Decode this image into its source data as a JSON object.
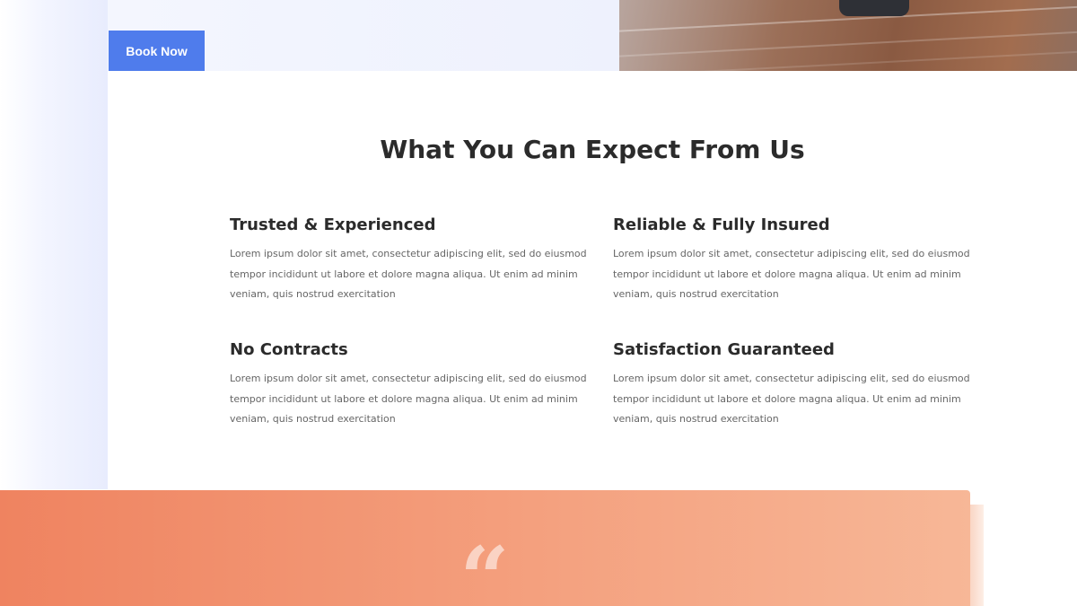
{
  "hero": {
    "book_button_label": "Book Now"
  },
  "features_section": {
    "title": "What You Can Expect From Us",
    "items": [
      {
        "title": "Trusted & Experienced",
        "body": "Lorem ipsum dolor sit amet, consectetur adipiscing elit, sed do eiusmod tempor incididunt ut labore et dolore magna aliqua. Ut enim ad minim veniam, quis nostrud exercitation"
      },
      {
        "title": "Reliable & Fully Insured",
        "body": "Lorem ipsum dolor sit amet, consectetur adipiscing elit, sed do eiusmod tempor incididunt ut labore et dolore magna aliqua. Ut enim ad minim veniam, quis nostrud exercitation"
      },
      {
        "title": "No Contracts",
        "body": "Lorem ipsum dolor sit amet, consectetur adipiscing elit, sed do eiusmod tempor incididunt ut labore et dolore magna aliqua. Ut enim ad minim veniam, quis nostrud exercitation"
      },
      {
        "title": "Satisfaction Guaranteed",
        "body": "Lorem ipsum dolor sit amet, consectetur adipiscing elit, sed do eiusmod tempor incididunt ut labore et dolore magna aliqua. Ut enim ad minim veniam, quis nostrud exercitation"
      }
    ]
  },
  "testimonial": {
    "quote_mark": "“"
  },
  "colors": {
    "accent": "#4f7cec",
    "testimonial_start": "#ef8360",
    "testimonial_end": "#f7b797",
    "heading": "#2b2b2b",
    "body_text": "#666666"
  },
  "icons": {
    "quote": "quote-icon",
    "hero_image": "hero-photo"
  }
}
